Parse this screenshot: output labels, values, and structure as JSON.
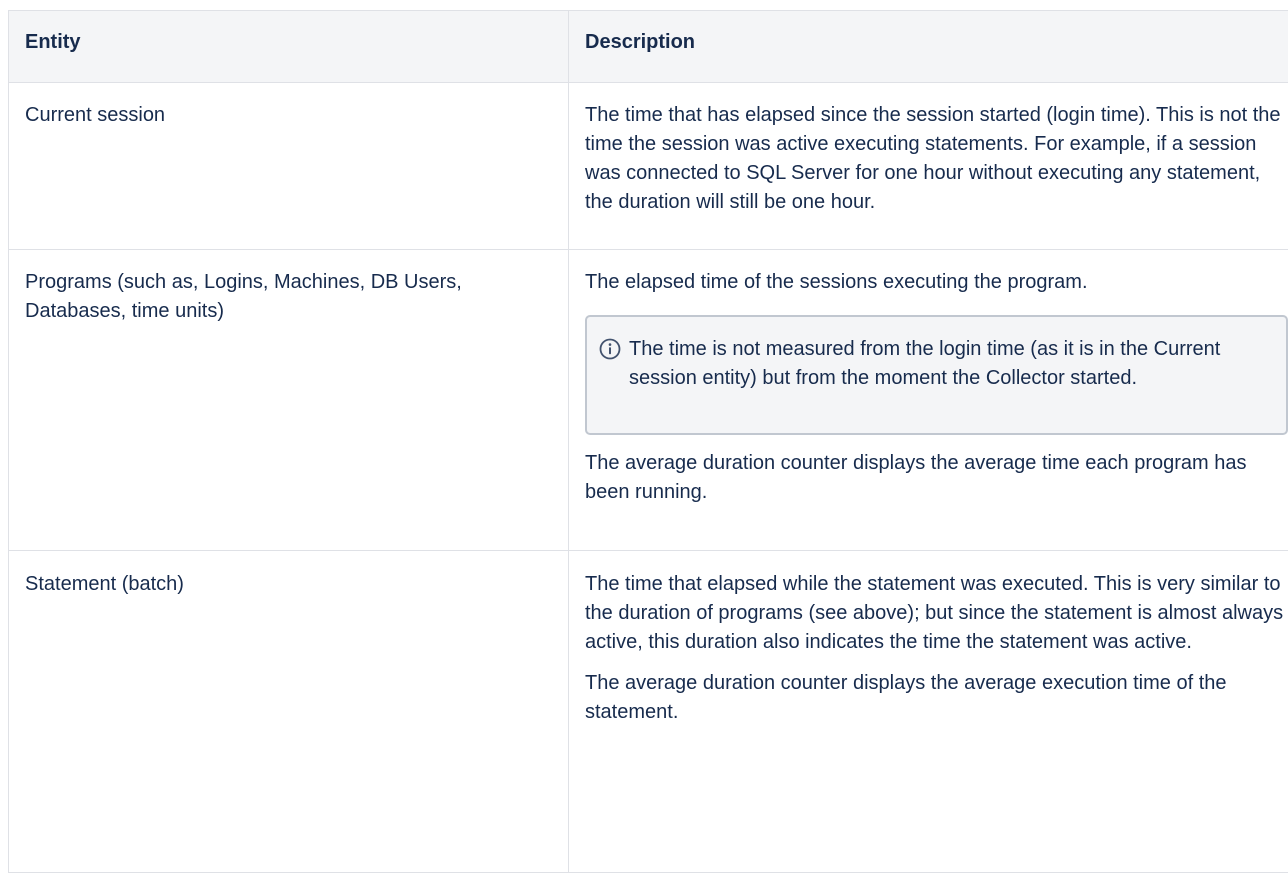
{
  "table": {
    "headers": {
      "entity": "Entity",
      "description": "Description"
    },
    "rows": [
      {
        "entity": "Current session",
        "paragraphs": [
          "The time that has elapsed since the session started (login time). This is not the time the session was active executing statements. For example, if a session was connected to SQL Server for one hour without executing any statement, the duration will still be one hour."
        ]
      },
      {
        "entity": "Programs (such as, Logins, Machines, DB Users, Databases, time units)",
        "paragraphs": [
          "The elapsed time of the sessions executing the program.",
          "The average duration counter displays the average time each program has been running."
        ],
        "info_panel": {
          "icon": "info-icon",
          "text": "The time is not measured from the login time (as it is in the Current session entity) but from the moment the Collector started."
        }
      },
      {
        "entity": "Statement (batch)",
        "paragraphs": [
          "The time that elapsed while the statement was executed. This is very similar to the duration of programs (see above); but since the statement is almost always active, this duration also indicates the time the statement was active.",
          "The average duration counter displays the average execution time of the statement."
        ]
      }
    ]
  },
  "colors": {
    "text": "#172b4d",
    "header_bg": "#f4f5f7",
    "border": "#dfe1e6",
    "panel_border": "#c1c7d0"
  }
}
